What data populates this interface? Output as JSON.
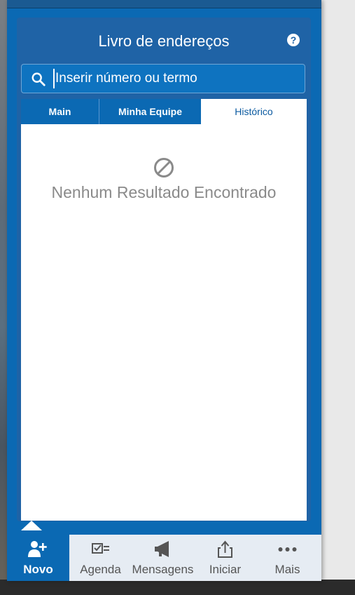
{
  "dialog": {
    "title": "Livro de endereços",
    "help_icon": "?"
  },
  "search": {
    "placeholder": "Inserir número ou termo"
  },
  "tabs": [
    {
      "label": "Main",
      "active": false
    },
    {
      "label": "Minha Equipe",
      "active": false
    },
    {
      "label": "Histórico",
      "active": true
    }
  ],
  "results": {
    "empty_message": "Nenhum Resultado Encontrado",
    "empty_icon": "no-results-icon"
  },
  "nav": [
    {
      "label": "Novo",
      "icon": "add-user-icon",
      "active": true
    },
    {
      "label": "Agenda",
      "icon": "agenda-icon",
      "active": false
    },
    {
      "label": "Mensagens",
      "icon": "megaphone-icon",
      "active": false
    },
    {
      "label": "Iniciar",
      "icon": "share-icon",
      "active": false
    },
    {
      "label": "Mais",
      "icon": "more-icon",
      "active": false
    }
  ],
  "colors": {
    "primary": "#0b69b3",
    "panel": "#1f63a6",
    "nav_bg": "#e6ecf3",
    "empty_text": "#8a8a8a"
  }
}
